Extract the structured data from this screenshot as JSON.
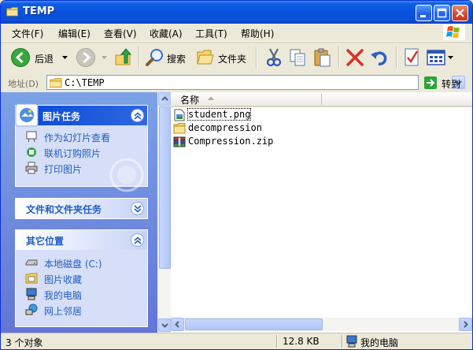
{
  "window": {
    "title": "TEMP"
  },
  "menu": {
    "items": [
      {
        "label": "文件(F)"
      },
      {
        "label": "编辑(E)"
      },
      {
        "label": "查看(V)"
      },
      {
        "label": "收藏(A)"
      },
      {
        "label": "工具(T)"
      },
      {
        "label": "帮助(H)"
      }
    ]
  },
  "toolbar": {
    "back_label": "后退",
    "search_label": "搜索",
    "folders_label": "文件夹"
  },
  "address": {
    "label": "地址(D)",
    "value": "C:\\TEMP",
    "go_label": "转到"
  },
  "taskpane": {
    "picture_tasks": {
      "title": "图片任务",
      "items": [
        {
          "label": "作为幻灯片查看"
        },
        {
          "label": "联机订购照片"
        },
        {
          "label": "打印图片"
        }
      ]
    },
    "file_folder_tasks": {
      "title": "文件和文件夹任务"
    },
    "other_places": {
      "title": "其它位置",
      "items": [
        {
          "label": "本地磁盘 (C:)"
        },
        {
          "label": "图片收藏"
        },
        {
          "label": "我的电脑"
        },
        {
          "label": "网上邻居"
        }
      ]
    }
  },
  "filelist": {
    "column_name": "名称",
    "files": [
      {
        "name": "student.png",
        "icon": "image-file-icon"
      },
      {
        "name": "decompression",
        "icon": "folder-icon"
      },
      {
        "name": "Compression.zip",
        "icon": "zip-archive-icon"
      }
    ]
  },
  "status": {
    "objects": "3 个对象",
    "size": "12.8 KB",
    "location": "我的电脑"
  },
  "colors": {
    "titlebar": "#0a4fd6",
    "taskpane_bg": "#6f8ee0",
    "panel_bg": "#d6dff7",
    "link": "#215dc6",
    "chrome": "#ece9d8"
  }
}
